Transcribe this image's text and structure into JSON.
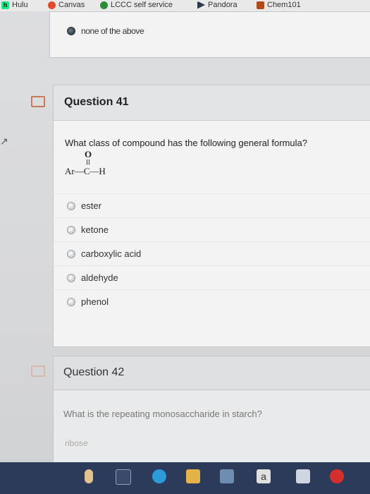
{
  "bookmarks": [
    {
      "label": "Hulu",
      "icon": "hulu-icon"
    },
    {
      "label": "Canvas",
      "icon": "canvas-icon"
    },
    {
      "label": "LCCC self service",
      "icon": "lccc-icon"
    },
    {
      "label": "Pandora",
      "icon": "pandora-icon"
    },
    {
      "label": "Chem101",
      "icon": "chem101-icon"
    }
  ],
  "prev_question": {
    "selected_choice": "none of the above"
  },
  "question41": {
    "title": "Question 41",
    "prompt": "What class of compound has the following general formula?",
    "formula": {
      "top": "O",
      "bond": "II",
      "main": "Ar—C—H"
    },
    "choices": [
      "ester",
      "ketone",
      "carboxylic acid",
      "aldehyde",
      "phenol"
    ]
  },
  "question42": {
    "title": "Question 42",
    "prompt": "What is the repeating monosaccharide in starch?",
    "choices": [
      "ribose"
    ]
  },
  "colors": {
    "panel": "#f3f3f4",
    "header": "#e3e4e6",
    "taskbar": "#2c3b5a",
    "flag": "#c87a5a"
  }
}
